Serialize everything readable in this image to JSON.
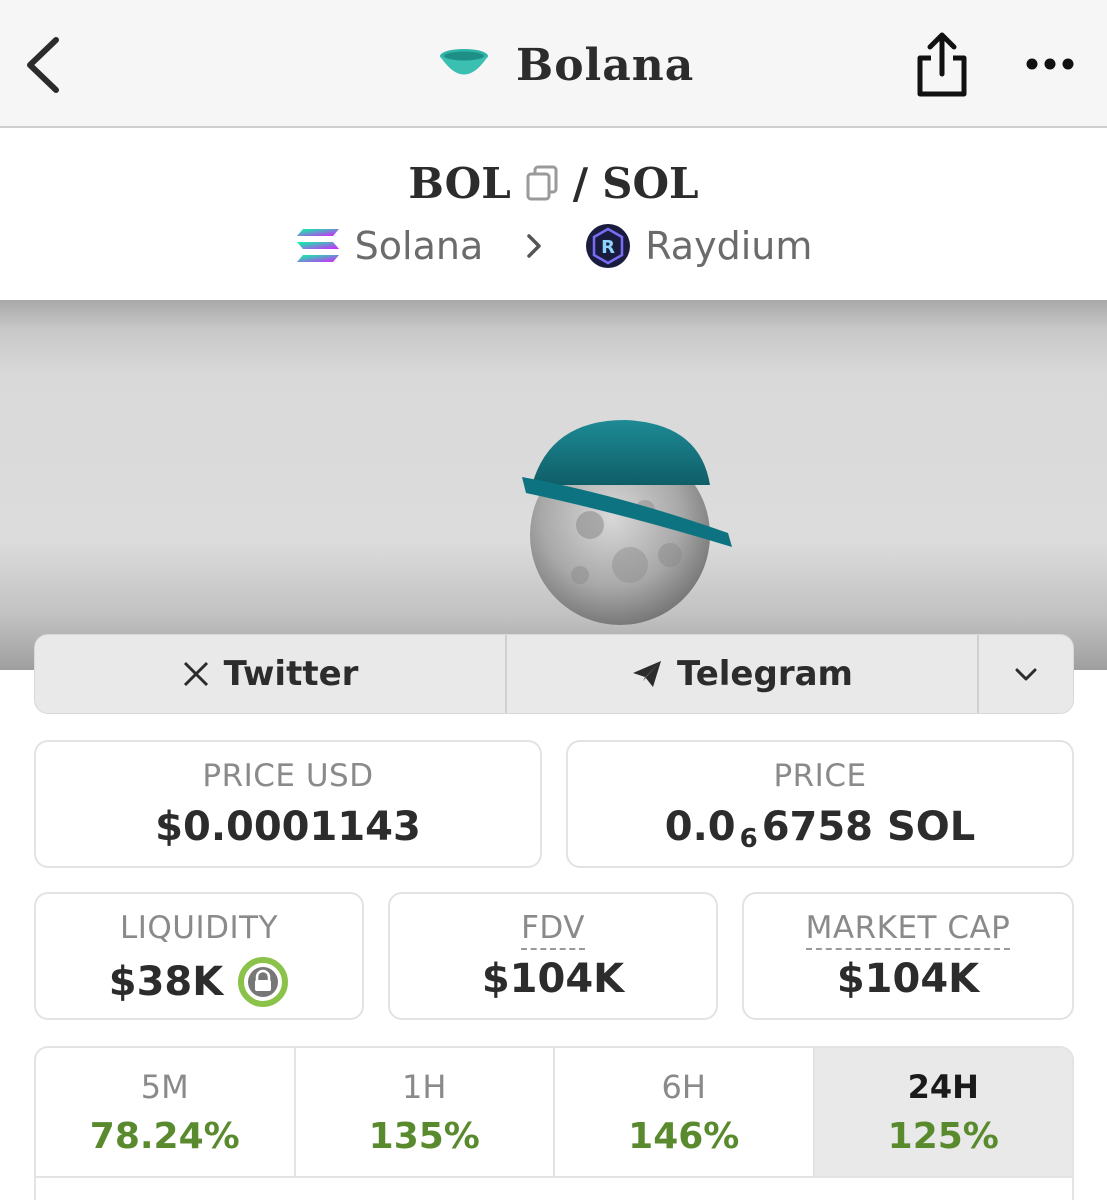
{
  "nav": {
    "back_icon": "chevron-left-icon",
    "title": "Bolana",
    "title_icon": "bowl-icon",
    "share_icon": "share-icon",
    "more_icon": "ellipsis-icon"
  },
  "pair": {
    "base": "BOL",
    "separator": "/",
    "quote": "SOL",
    "copy_icon": "copy-icon"
  },
  "chain": {
    "network": "Solana",
    "dex": "Raydium",
    "network_icon": "solana-logo-icon",
    "dex_icon": "raydium-logo-icon"
  },
  "social": {
    "twitter_label": "Twitter",
    "telegram_label": "Telegram",
    "more_icon": "chevron-down-icon"
  },
  "stats": {
    "price_usd_label": "PRICE USD",
    "price_usd_value": "$0.0001143",
    "price_label": "PRICE",
    "price_value_prefix": "0.0",
    "price_value_zeros": "6",
    "price_value_suffix": "6758 SOL",
    "liquidity_label": "LIQUIDITY",
    "liquidity_value": "$38K",
    "fdv_label": "FDV",
    "fdv_value": "$104K",
    "market_cap_label": "MARKET CAP",
    "market_cap_value": "$104K"
  },
  "timeframes": [
    {
      "label": "5M",
      "value": "78.24%"
    },
    {
      "label": "1H",
      "value": "135%"
    },
    {
      "label": "6H",
      "value": "146%"
    },
    {
      "label": "24H",
      "value": "125%",
      "active": true
    }
  ],
  "colors": {
    "positive": "#5a8a2e",
    "accent_bowl": "#1f7f86",
    "lock_ring": "#8bc34a"
  }
}
